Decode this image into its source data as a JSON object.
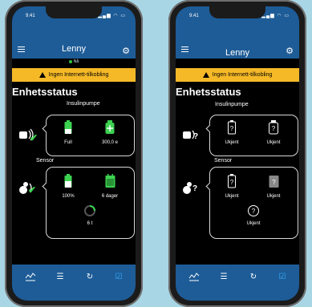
{
  "status_bar": {
    "time": "9:41"
  },
  "header": {
    "title": "Lenny",
    "connection_status": "Nå"
  },
  "alert": {
    "text": "Ingen Internett-tilkobling"
  },
  "page_title": "Enhetsstatus",
  "left_screen": {
    "pump_label": "Insulinpumpe",
    "pump_battery": "Full",
    "pump_reservoir": "300,0 e",
    "sensor_label": "Sensor",
    "sensor_battery": "100%",
    "sensor_remaining": "6 dager",
    "sensor_warmup": "6 t"
  },
  "right_screen": {
    "pump_label": "Insulinpumpe",
    "pump_battery": "Ukjent",
    "pump_reservoir": "Ukjent",
    "sensor_label": "Sensor",
    "sensor_battery": "Ukjent",
    "sensor_remaining": "Ukjent",
    "sensor_status": "Ukjent"
  },
  "colors": {
    "header_blue": "#1e5c97",
    "alert_yellow": "#f5b928",
    "ok_green": "#3cd250",
    "active_tab": "#35b0ff"
  },
  "nav": {
    "items": [
      "chart-icon",
      "list-icon",
      "history-icon",
      "checklist-icon"
    ],
    "active": "checklist-icon"
  }
}
